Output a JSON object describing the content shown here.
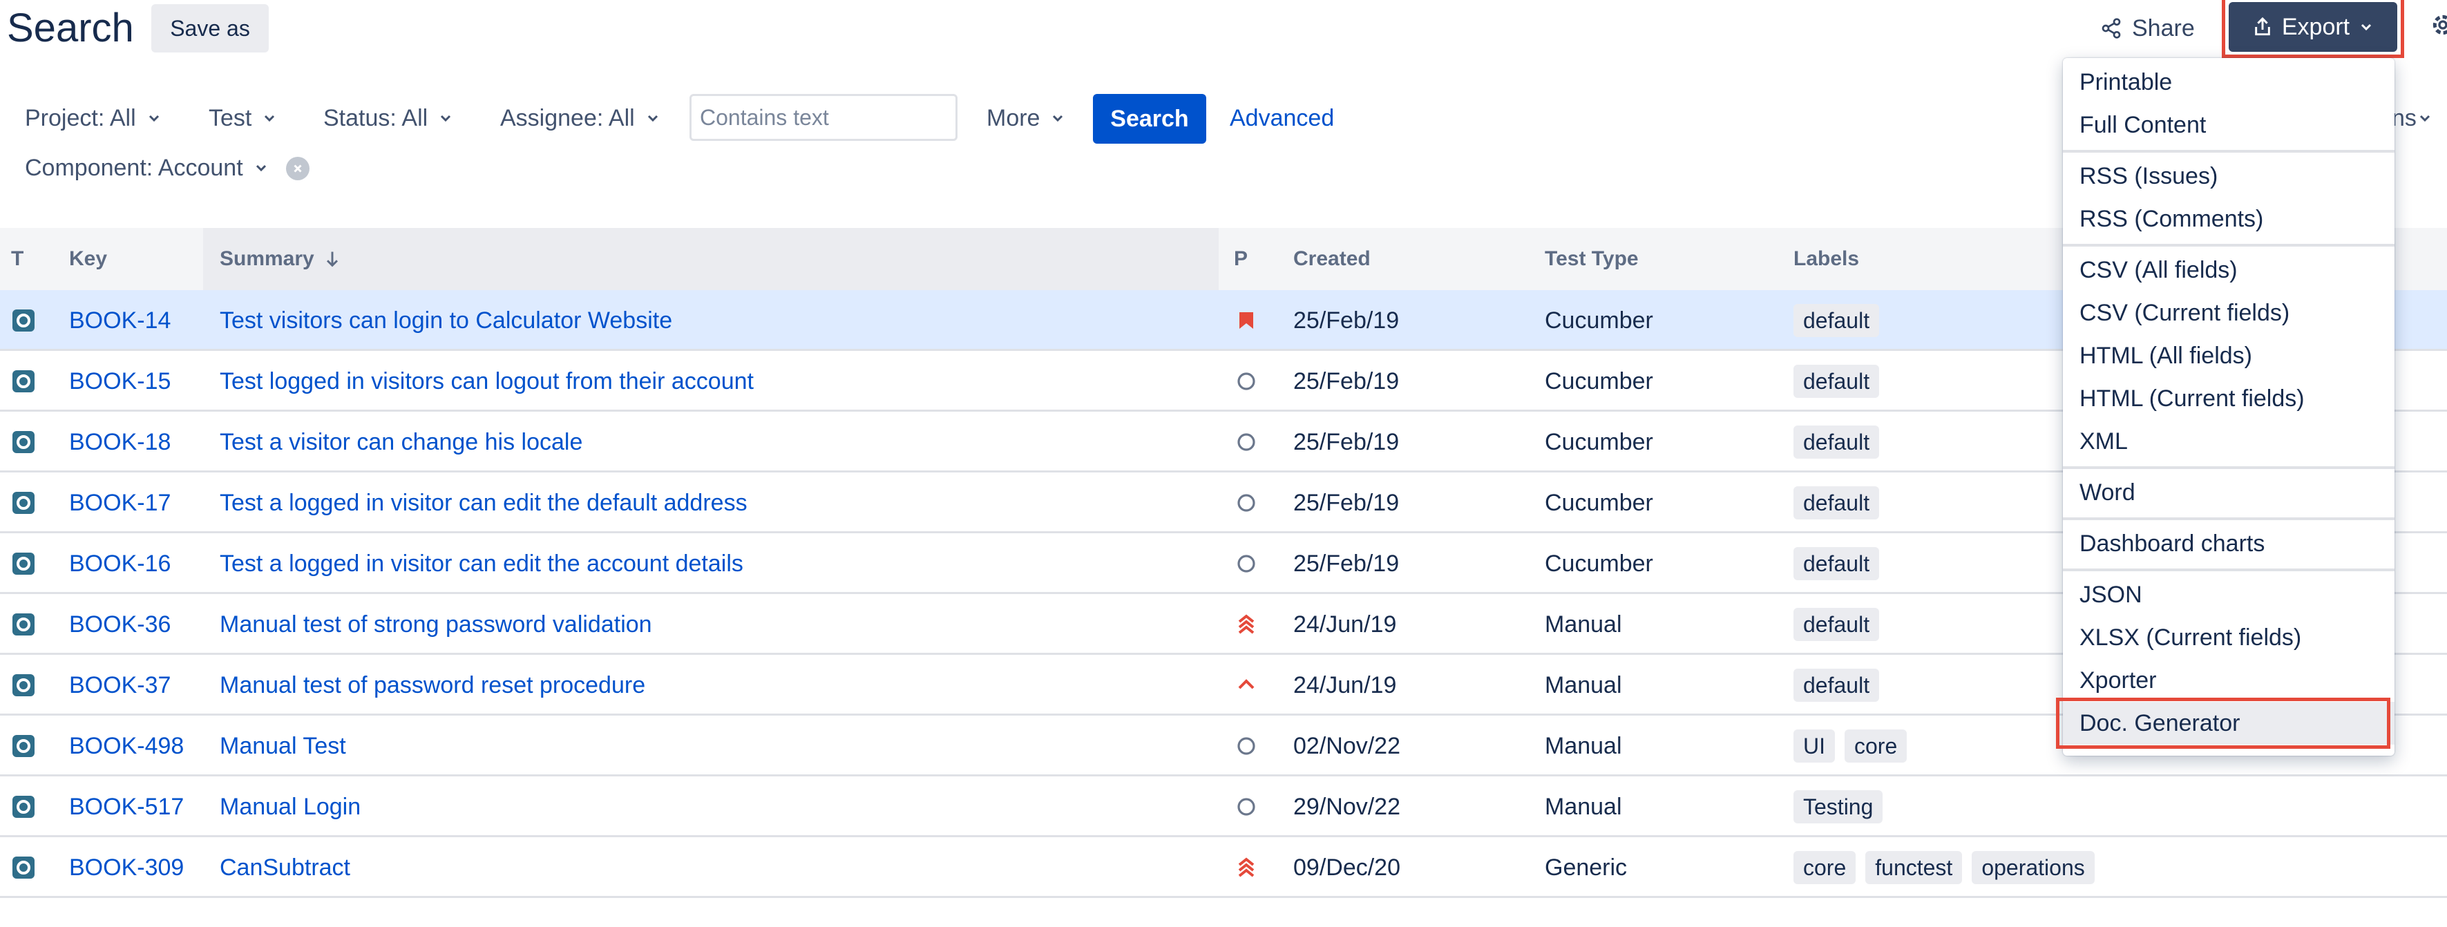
{
  "header": {
    "title": "Search",
    "save_as_label": "Save as",
    "share_label": "Share",
    "export_label": "Export"
  },
  "filters": {
    "project": "Project: All",
    "test": "Test",
    "status": "Status: All",
    "assignee": "Assignee: All",
    "contains_placeholder": "Contains text",
    "more": "More",
    "search_button": "Search",
    "advanced": "Advanced",
    "component": "Component: Account",
    "columns_fragment": "ns"
  },
  "table": {
    "columns": [
      "T",
      "Key",
      "Summary",
      "P",
      "Created",
      "Test Type",
      "Labels"
    ],
    "rows": [
      {
        "key": "BOOK-14",
        "summary": "Test visitors can login to Calculator Website",
        "priority": "highest",
        "created": "25/Feb/19",
        "test_type": "Cucumber",
        "labels": [
          "default"
        ]
      },
      {
        "key": "BOOK-15",
        "summary": "Test logged in visitors can logout from their account",
        "priority": "none",
        "created": "25/Feb/19",
        "test_type": "Cucumber",
        "labels": [
          "default"
        ]
      },
      {
        "key": "BOOK-18",
        "summary": "Test a visitor can change his locale",
        "priority": "none",
        "created": "25/Feb/19",
        "test_type": "Cucumber",
        "labels": [
          "default"
        ]
      },
      {
        "key": "BOOK-17",
        "summary": "Test a logged in visitor can edit the default address",
        "priority": "none",
        "created": "25/Feb/19",
        "test_type": "Cucumber",
        "labels": [
          "default"
        ]
      },
      {
        "key": "BOOK-16",
        "summary": "Test a logged in visitor can edit the account details",
        "priority": "none",
        "created": "25/Feb/19",
        "test_type": "Cucumber",
        "labels": [
          "default"
        ]
      },
      {
        "key": "BOOK-36",
        "summary": "Manual test of strong password validation",
        "priority": "critical",
        "created": "24/Jun/19",
        "test_type": "Manual",
        "labels": [
          "default"
        ]
      },
      {
        "key": "BOOK-37",
        "summary": "Manual test of password reset procedure",
        "priority": "major",
        "created": "24/Jun/19",
        "test_type": "Manual",
        "labels": [
          "default"
        ]
      },
      {
        "key": "BOOK-498",
        "summary": "Manual Test",
        "priority": "none",
        "created": "02/Nov/22",
        "test_type": "Manual",
        "labels": [
          "UI",
          "core"
        ]
      },
      {
        "key": "BOOK-517",
        "summary": "Manual Login",
        "priority": "none",
        "created": "29/Nov/22",
        "test_type": "Manual",
        "labels": [
          "Testing"
        ]
      },
      {
        "key": "BOOK-309",
        "summary": "CanSubtract",
        "priority": "critical",
        "created": "09/Dec/20",
        "test_type": "Generic",
        "labels": [
          "core",
          "functest",
          "operations"
        ]
      }
    ]
  },
  "export_menu": {
    "groups": [
      [
        "Printable",
        "Full Content"
      ],
      [
        "RSS (Issues)",
        "RSS (Comments)"
      ],
      [
        "CSV (All fields)",
        "CSV (Current fields)",
        "HTML (All fields)",
        "HTML (Current fields)",
        "XML"
      ],
      [
        "Word"
      ],
      [
        "Dashboard charts"
      ],
      [
        "JSON",
        "XLSX (Current fields)",
        "Xporter",
        "Doc. Generator"
      ]
    ],
    "highlighted": "Doc. Generator"
  },
  "colors": {
    "link": "#0052cc",
    "export_bg": "#344563",
    "highlight_box": "#e5493a",
    "selected_row": "#deebff",
    "priority": "#e5493a"
  }
}
